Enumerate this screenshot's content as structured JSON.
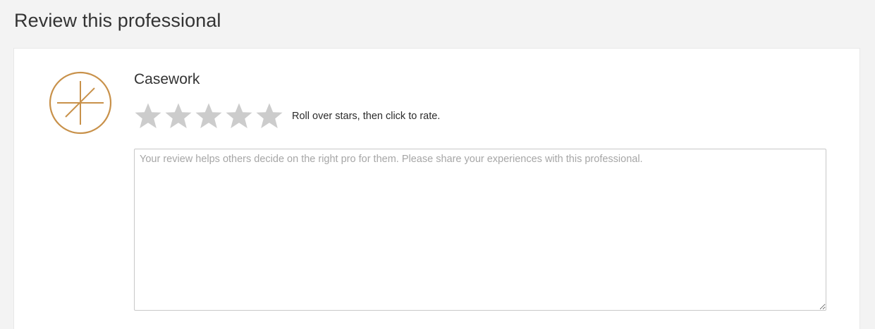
{
  "page": {
    "title": "Review this professional"
  },
  "professional": {
    "name": "Casework",
    "logo_icon": "casework-logo-icon",
    "logo_color": "#c8914a"
  },
  "rating": {
    "max_stars": 5,
    "current_rating": 0,
    "star_color": "#cccccc",
    "hint": "Roll over stars, then click to rate."
  },
  "review": {
    "value": "",
    "placeholder": "Your review helps others decide on the right pro for them. Please share your experiences with this professional."
  }
}
